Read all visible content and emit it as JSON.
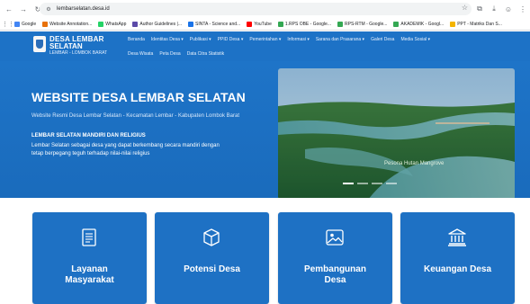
{
  "browser": {
    "url": "lembarselatan.desa.id",
    "bookmarks": [
      {
        "label": "Google",
        "color": "#4285f4"
      },
      {
        "label": "Website Annotation...",
        "color": "#e8710a"
      },
      {
        "label": "WhatsApp",
        "color": "#25d366"
      },
      {
        "label": "Author Guidelines |...",
        "color": "#5b4aa8"
      },
      {
        "label": "SINTA - Science and...",
        "color": "#1a73e8"
      },
      {
        "label": "YouTube",
        "color": "#ff0000"
      },
      {
        "label": "1.RPS OBE - Google...",
        "color": "#34a853"
      },
      {
        "label": "RPS-RTM - Google...",
        "color": "#34a853"
      },
      {
        "label": "AKADEMIK - Googl...",
        "color": "#34a853"
      },
      {
        "label": "PPT - Matriks Dan S...",
        "color": "#f4b400"
      }
    ]
  },
  "site": {
    "brand_line1": "DESA LEMBAR",
    "brand_line2": "SELATAN",
    "brand_line3": "LEMBAR - LOMBOK BARAT",
    "menu_row1": [
      "Beranda",
      "Identitas Desa ▾",
      "Publikasi ▾",
      "PPID Desa ▾",
      "Pemerintahan ▾",
      "Informasi ▾",
      "Sarana dan Prasarana ▾",
      "Galeri Desa",
      "Media Sosial ▾"
    ],
    "menu_row2": [
      "Desa Wisata",
      "Peta Desa",
      "Data Citra Statistik"
    ]
  },
  "hero": {
    "title": "WEBSITE DESA LEMBAR SELATAN",
    "subtitle": "Website Resmi Desa Lembar Selatan - Kecamatan Lembar - Kabupaten Lombok Barat",
    "motto": "LEMBAR SELATAN MANDIRI DAN RELIGIUS",
    "description_line1": "Lembar Selatan sebagai desa yang dapat berkembang secara mandiri dengan",
    "description_line2": "tetap berpegang teguh terhadap nilai-nilai religius",
    "slide_caption": "Pesona Hutan Mangrove",
    "slide_count": 4,
    "active_slide": 0
  },
  "cards": [
    {
      "label": "Layanan\nMasyarakat",
      "icon": "document-list-icon"
    },
    {
      "label": "Potensi Desa",
      "icon": "cube-icon"
    },
    {
      "label": "Pembangunan\nDesa",
      "icon": "image-icon"
    },
    {
      "label": "Keuangan Desa",
      "icon": "bank-icon"
    }
  ],
  "colors": {
    "primary": "#1d72c6",
    "card": "#1e71c4"
  }
}
